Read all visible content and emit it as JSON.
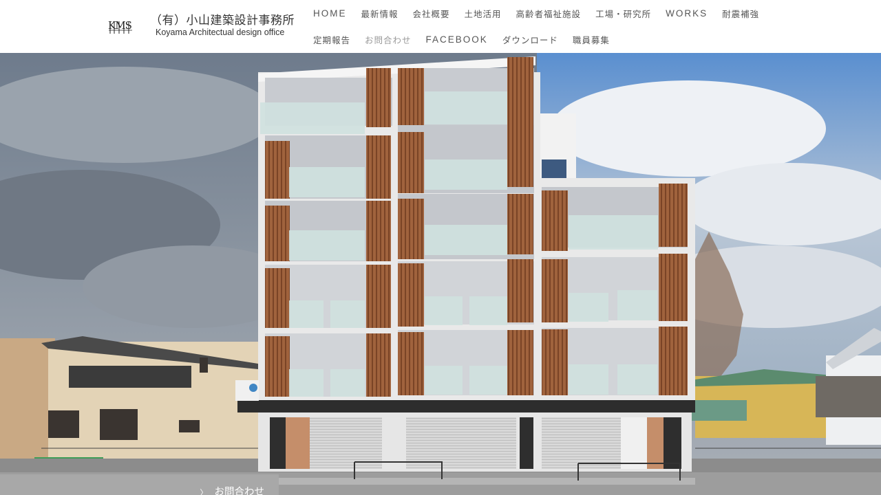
{
  "logo": {
    "mark": "KMS",
    "title": "（有）小山建築設計事務所",
    "subtitle": "Koyama Architectual design office"
  },
  "nav": {
    "row1": [
      "HOME",
      "最新情報",
      "会社概要",
      "土地活用",
      "高齢者福祉施設",
      "工場・研究所",
      "WORKS",
      "耐震補強"
    ],
    "row2": [
      "定期報告",
      "お問合わせ",
      "FACEBOOK",
      "ダウンロード",
      "職員募集"
    ]
  },
  "hero": {
    "image": "apartment-building-photo"
  },
  "contact_tab": {
    "label": "お問合わせ",
    "chevron": "〉"
  },
  "colors": {
    "nav_text": "#555555",
    "contact_tab_bg": "#a8a8a8",
    "wood": "#a0633d"
  }
}
